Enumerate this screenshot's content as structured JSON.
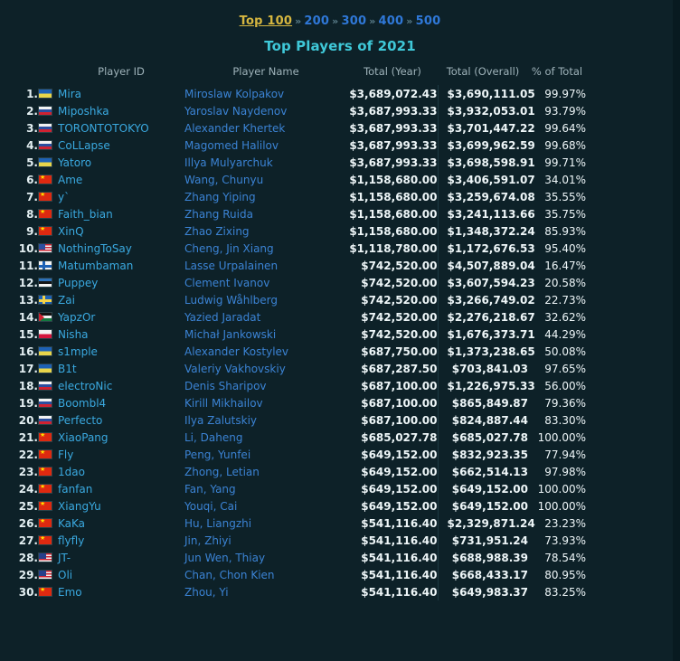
{
  "nav": {
    "current": "Top 100",
    "pages": [
      "200",
      "300",
      "400",
      "500"
    ],
    "separator": "»"
  },
  "title": "Top Players of 2021",
  "table": {
    "headers": {
      "rank": "",
      "player_id": "Player ID",
      "player_name": "Player Name",
      "total_year": "Total (Year)",
      "total_overall": "Total (Overall)",
      "pct_of_total": "% of Total"
    },
    "rows": [
      {
        "rank": "1.",
        "flag": "f-ua",
        "country": "ukraine",
        "id": "Mira",
        "name": "Miroslaw Kolpakov",
        "year": "$3,689,072.43",
        "overall": "$3,690,111.05",
        "pct": "99.97%"
      },
      {
        "rank": "2.",
        "flag": "f-ru",
        "country": "russia",
        "id": "Miposhka",
        "name": "Yaroslav Naydenov",
        "year": "$3,687,993.33",
        "overall": "$3,932,053.01",
        "pct": "93.79%"
      },
      {
        "rank": "3.",
        "flag": "f-ru",
        "country": "russia",
        "id": "TORONTOTOKYO",
        "name": "Alexander Khertek",
        "year": "$3,687,993.33",
        "overall": "$3,701,447.22",
        "pct": "99.64%"
      },
      {
        "rank": "4.",
        "flag": "f-ru",
        "country": "russia",
        "id": "CoLLapse",
        "name": "Magomed Halilov",
        "year": "$3,687,993.33",
        "overall": "$3,699,962.59",
        "pct": "99.68%"
      },
      {
        "rank": "5.",
        "flag": "f-ua",
        "country": "ukraine",
        "id": "Yatoro",
        "name": "Illya Mulyarchuk",
        "year": "$3,687,993.33",
        "overall": "$3,698,598.91",
        "pct": "99.71%"
      },
      {
        "rank": "6.",
        "flag": "f-cn",
        "country": "china",
        "id": "Ame",
        "name": "Wang, Chunyu",
        "year": "$1,158,680.00",
        "overall": "$3,406,591.07",
        "pct": "34.01%"
      },
      {
        "rank": "7.",
        "flag": "f-cn",
        "country": "china",
        "id": "y`",
        "name": "Zhang Yiping",
        "year": "$1,158,680.00",
        "overall": "$3,259,674.08",
        "pct": "35.55%"
      },
      {
        "rank": "8.",
        "flag": "f-cn",
        "country": "china",
        "id": "Faith_bian",
        "name": "Zhang Ruida",
        "year": "$1,158,680.00",
        "overall": "$3,241,113.66",
        "pct": "35.75%"
      },
      {
        "rank": "9.",
        "flag": "f-cn",
        "country": "china",
        "id": "XinQ",
        "name": "Zhao Zixing",
        "year": "$1,158,680.00",
        "overall": "$1,348,372.24",
        "pct": "85.93%"
      },
      {
        "rank": "10.",
        "flag": "f-us",
        "country": "usa",
        "id": "NothingToSay",
        "name": "Cheng, Jin Xiang",
        "year": "$1,118,780.00",
        "overall": "$1,172,676.53",
        "pct": "95.40%"
      },
      {
        "rank": "11.",
        "flag": "f-fi",
        "country": "finland",
        "id": "Matumbaman",
        "name": "Lasse Urpalainen",
        "year": "$742,520.00",
        "overall": "$4,507,889.04",
        "pct": "16.47%"
      },
      {
        "rank": "12.",
        "flag": "f-ee",
        "country": "estonia",
        "id": "Puppey",
        "name": "Clement Ivanov",
        "year": "$742,520.00",
        "overall": "$3,607,594.23",
        "pct": "20.58%"
      },
      {
        "rank": "13.",
        "flag": "f-se",
        "country": "sweden",
        "id": "Zai",
        "name": "Ludwig Wåhlberg",
        "year": "$742,520.00",
        "overall": "$3,266,749.02",
        "pct": "22.73%"
      },
      {
        "rank": "14.",
        "flag": "f-jo",
        "country": "jordan",
        "id": "YapzOr",
        "name": "Yazied Jaradat",
        "year": "$742,520.00",
        "overall": "$2,276,218.67",
        "pct": "32.62%"
      },
      {
        "rank": "15.",
        "flag": "f-pl",
        "country": "poland",
        "id": "Nisha",
        "name": "Michał Jankowski",
        "year": "$742,520.00",
        "overall": "$1,676,373.71",
        "pct": "44.29%"
      },
      {
        "rank": "16.",
        "flag": "f-ua",
        "country": "ukraine",
        "id": "s1mple",
        "name": "Alexander Kostylev",
        "year": "$687,750.00",
        "overall": "$1,373,238.65",
        "pct": "50.08%"
      },
      {
        "rank": "17.",
        "flag": "f-ua",
        "country": "ukraine",
        "id": "B1t",
        "name": "Valeriy Vakhovskiy",
        "year": "$687,287.50",
        "overall": "$703,841.03",
        "pct": "97.65%"
      },
      {
        "rank": "18.",
        "flag": "f-ru",
        "country": "russia",
        "id": "electroNic",
        "name": "Denis Sharipov",
        "year": "$687,100.00",
        "overall": "$1,226,975.33",
        "pct": "56.00%"
      },
      {
        "rank": "19.",
        "flag": "f-ru",
        "country": "russia",
        "id": "Boombl4",
        "name": "Kirill Mikhailov",
        "year": "$687,100.00",
        "overall": "$865,849.87",
        "pct": "79.36%"
      },
      {
        "rank": "20.",
        "flag": "f-ru",
        "country": "russia",
        "id": "Perfecto",
        "name": "Ilya Zalutskiy",
        "year": "$687,100.00",
        "overall": "$824,887.44",
        "pct": "83.30%"
      },
      {
        "rank": "21.",
        "flag": "f-cn",
        "country": "china",
        "id": "XiaoPang",
        "name": "Li, Daheng",
        "year": "$685,027.78",
        "overall": "$685,027.78",
        "pct": "100.00%"
      },
      {
        "rank": "22.",
        "flag": "f-cn",
        "country": "china",
        "id": "Fly",
        "name": "Peng, Yunfei",
        "year": "$649,152.00",
        "overall": "$832,923.35",
        "pct": "77.94%"
      },
      {
        "rank": "23.",
        "flag": "f-cn",
        "country": "china",
        "id": "1dao",
        "name": "Zhong, Letian",
        "year": "$649,152.00",
        "overall": "$662,514.13",
        "pct": "97.98%"
      },
      {
        "rank": "24.",
        "flag": "f-cn",
        "country": "china",
        "id": "fanfan",
        "name": "Fan, Yang",
        "year": "$649,152.00",
        "overall": "$649,152.00",
        "pct": "100.00%"
      },
      {
        "rank": "25.",
        "flag": "f-cn",
        "country": "china",
        "id": "XiangYu",
        "name": "Youqi, Cai",
        "year": "$649,152.00",
        "overall": "$649,152.00",
        "pct": "100.00%"
      },
      {
        "rank": "26.",
        "flag": "f-cn",
        "country": "china",
        "id": "KaKa",
        "name": "Hu, Liangzhi",
        "year": "$541,116.40",
        "overall": "$2,329,871.24",
        "pct": "23.23%"
      },
      {
        "rank": "27.",
        "flag": "f-cn",
        "country": "china",
        "id": "flyfly",
        "name": "Jin, Zhiyi",
        "year": "$541,116.40",
        "overall": "$731,951.24",
        "pct": "73.93%"
      },
      {
        "rank": "28.",
        "flag": "f-my",
        "country": "malaysia",
        "id": "JT-",
        "name": "Jun Wen, Thiay",
        "year": "$541,116.40",
        "overall": "$688,988.39",
        "pct": "78.54%"
      },
      {
        "rank": "29.",
        "flag": "f-my",
        "country": "malaysia",
        "id": "Oli",
        "name": "Chan, Chon Kien",
        "year": "$541,116.40",
        "overall": "$668,433.17",
        "pct": "80.95%"
      },
      {
        "rank": "30.",
        "flag": "f-cn",
        "country": "china",
        "id": "Emo",
        "name": "Zhou, Yi",
        "year": "$541,116.40",
        "overall": "$649,983.37",
        "pct": "83.25%"
      }
    ]
  },
  "colors": {
    "background": "#0d2128",
    "nav_current": "#d7b740",
    "nav_link": "#2f78d8",
    "title": "#3fc8d8",
    "player_id_link": "#3aa9e0",
    "player_name_link": "#3b83d4",
    "header_text": "#9fb3ba",
    "value_text": "#eef6f8"
  }
}
